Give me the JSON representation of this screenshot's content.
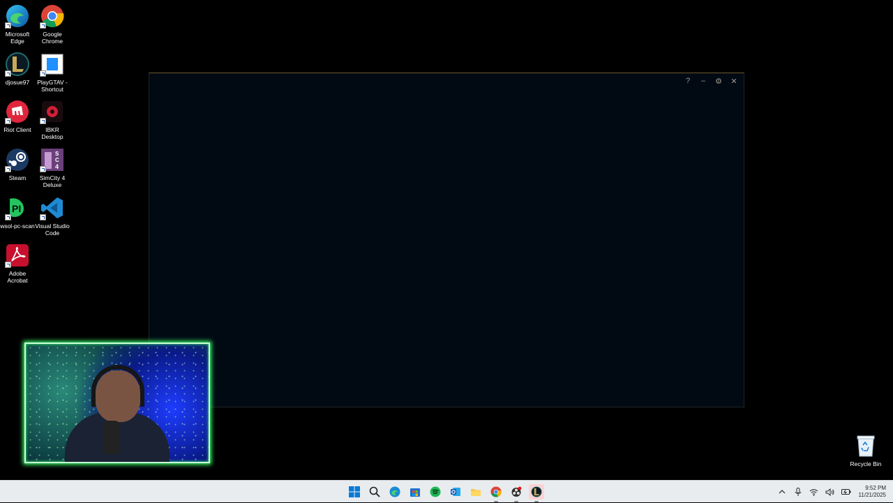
{
  "desktop": {
    "icons": [
      {
        "label": "Microsoft Edge"
      },
      {
        "label": "Google Chrome"
      },
      {
        "label": "djosue97"
      },
      {
        "label": "PlayGTAV - Shortcut"
      },
      {
        "label": "Riot Client"
      },
      {
        "label": "IBKR Desktop"
      },
      {
        "label": "Steam"
      },
      {
        "label": "SimCity 4 Deluxe"
      },
      {
        "label": "wsol-pc-scan"
      },
      {
        "label": "Visual Studio Code"
      },
      {
        "label": "Adobe Acrobat"
      }
    ],
    "recycle_bin_label": "Recycle Bin"
  },
  "client_window": {
    "controls": {
      "help": "?",
      "minimize": "–",
      "settings": "⚙",
      "close": "✕"
    }
  },
  "taskbar": {
    "clock": {
      "time": "9:52 PM",
      "date": "11/21/2025"
    }
  },
  "colors": {
    "client_bg": "#010a13",
    "client_border_gold": "#6b5a2d",
    "webcam_glow": "#3bff6c",
    "taskbar_bg": "#e9ecef"
  }
}
